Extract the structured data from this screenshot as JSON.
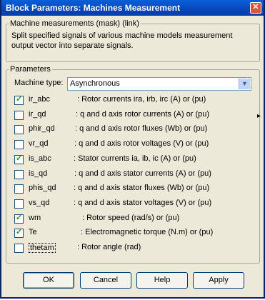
{
  "window": {
    "title": "Block Parameters: Machines Measurement",
    "close_icon": "close-icon"
  },
  "info": {
    "legend": "Machine measurements (mask) (link)",
    "text": "Split specified signals of various machine models measurement output vector into separate signals."
  },
  "params": {
    "legend": "Parameters",
    "machine_type_label": "Machine type:",
    "machine_type_value": "Asynchronous",
    "rows": [
      {
        "name": "ir_abc",
        "desc": ": Rotor currents ira, irb, irc (A) or (pu)",
        "checked": true
      },
      {
        "name": "ir_qd",
        "desc": ": q and d axis rotor currents (A) or (pu)",
        "checked": false
      },
      {
        "name": "phir_qd",
        "desc": ": q and d axis rotor fluxes (Wb) or (pu)",
        "checked": false
      },
      {
        "name": "vr_qd",
        "desc": ": q and d axis rotor voltages (V) or (pu)",
        "checked": false
      },
      {
        "name": "is_abc",
        "desc": ": Stator currents ia, ib, ic (A) or (pu)",
        "checked": true
      },
      {
        "name": "is_qd",
        "desc": ": q and d axis stator currents (A) or (pu)",
        "checked": false
      },
      {
        "name": "phis_qd",
        "desc": ": q and d axis stator fluxes (Wb) or (pu)",
        "checked": false
      },
      {
        "name": "vs_qd",
        "desc": ": q and d axis stator voltages (V) or (pu)",
        "checked": false
      },
      {
        "name": "wm",
        "desc": ": Rotor speed (rad/s) or (pu)",
        "checked": true
      },
      {
        "name": "Te",
        "desc": ": Electromagnetic torque (N.m) or (pu)",
        "checked": true
      },
      {
        "name": "thetam",
        "desc": ": Rotor angle (rad)",
        "checked": false
      }
    ]
  },
  "buttons": {
    "ok": "OK",
    "cancel": "Cancel",
    "help": "Help",
    "apply": "Apply"
  }
}
